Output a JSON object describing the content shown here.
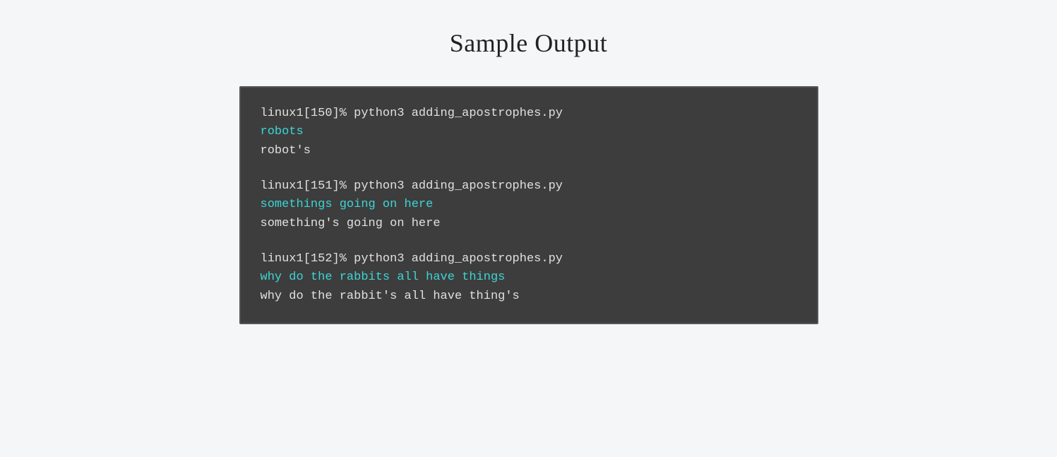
{
  "page": {
    "title": "Sample Output",
    "background": "#f5f6f7"
  },
  "terminal": {
    "background": "#3d3d3d",
    "blocks": [
      {
        "cmd": "linux1[150]% python3 adding_apostrophes.py",
        "input": "robots",
        "output": "robot's"
      },
      {
        "cmd": "linux1[151]% python3 adding_apostrophes.py",
        "input": "somethings going on here",
        "output": "something's going on here"
      },
      {
        "cmd": "linux1[152]% python3 adding_apostrophes.py",
        "input": "why do the rabbits all have things",
        "output": "why do the rabbit's all have thing's"
      }
    ]
  }
}
